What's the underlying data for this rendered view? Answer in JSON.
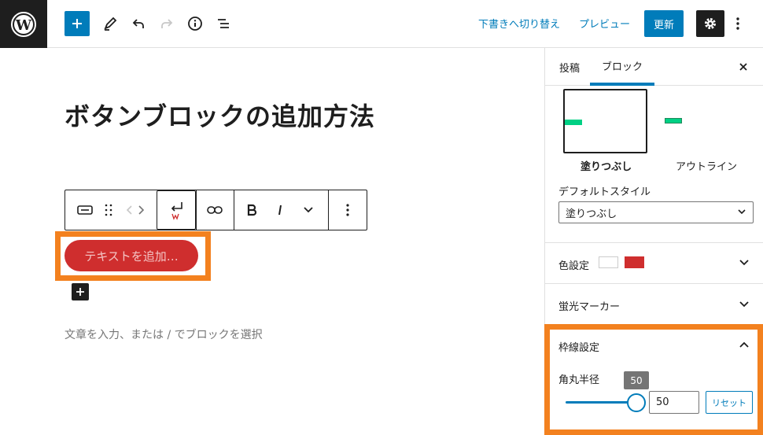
{
  "topbar": {
    "preview_draft_label": "下書きへ切り替え",
    "preview_label": "プレビュー",
    "update_label": "更新"
  },
  "editor": {
    "post_title": "ボタンブロックの追加方法",
    "button_text": "テキストを追加…",
    "placeholder": "文章を入力、または / でブロックを選択"
  },
  "sidebar": {
    "tabs": [
      "投稿",
      "ブロック"
    ],
    "styles": [
      {
        "label": "塗りつぶし",
        "selected": true
      },
      {
        "label": "アウトライン",
        "selected": false
      }
    ],
    "default_style_label": "デフォルトスタイル",
    "default_style_value": "塗りつぶし",
    "panels": {
      "color": "色設定",
      "marker": "蛍光マーカー",
      "border": "枠線設定"
    },
    "border_radius_label": "角丸半径",
    "border_radius_value": "50",
    "tooltip_value": "50",
    "reset_label": "リセット",
    "colors": {
      "text": "#ffffff",
      "background": "#cf2e2e"
    }
  },
  "colors": {
    "accent": "#007cba",
    "highlight": "#f3811f",
    "button_bg": "#cf2e2e",
    "mini_button": "#00d084"
  }
}
